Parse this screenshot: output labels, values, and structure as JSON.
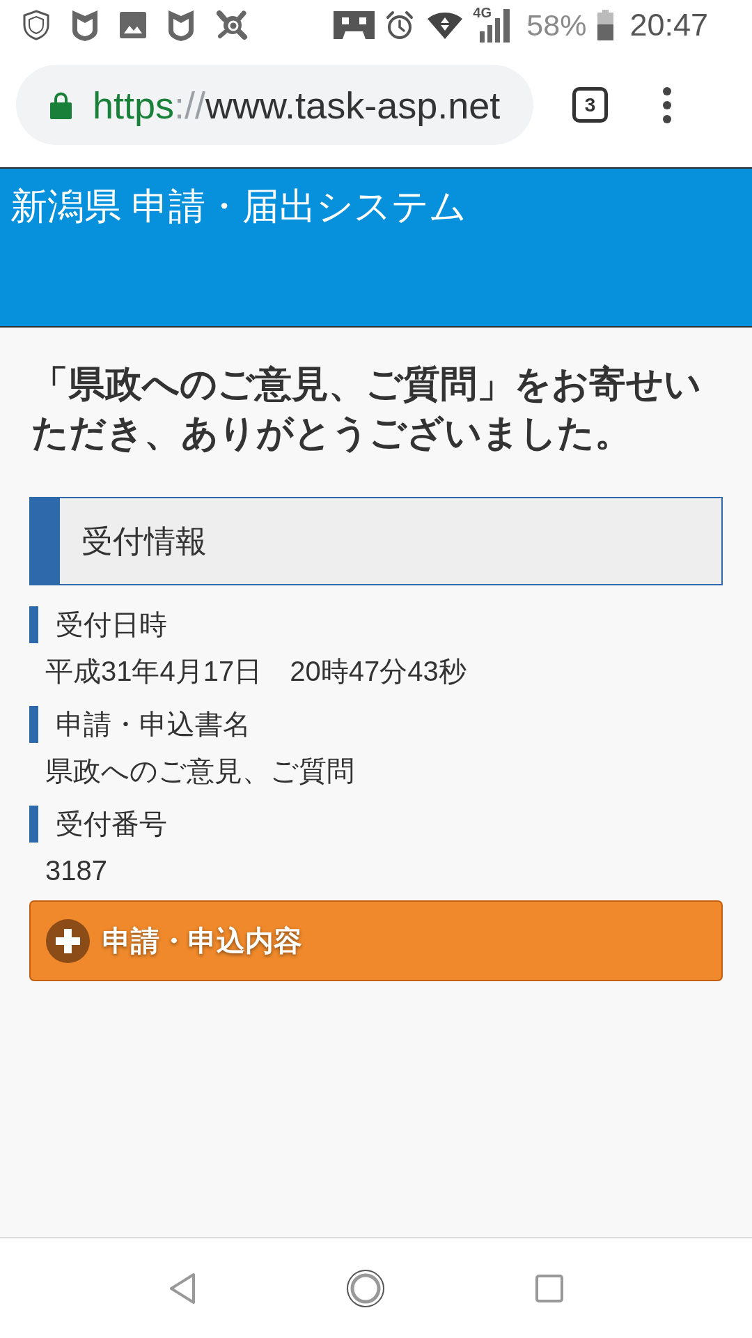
{
  "status_bar": {
    "network": "4G",
    "battery": "58%",
    "time": "20:47"
  },
  "browser": {
    "url": {
      "scheme": "https",
      "separator": "://",
      "host": "www.task-asp.net"
    },
    "tab_count": "3"
  },
  "header": {
    "title": "新潟県 申請・届出システム"
  },
  "message": "「県政へのご意見、ご質問」をお寄せいただき、ありがとうございました。",
  "section": {
    "title": "受付情報"
  },
  "fields": [
    {
      "label": "受付日時",
      "value": "平成31年4月17日　20時47分43秒"
    },
    {
      "label": "申請・申込書名",
      "value": "県政へのご意見、ご質問"
    },
    {
      "label": "受付番号",
      "value": "3187"
    }
  ],
  "expand_button": {
    "label": "申請・申込内容",
    "expanded": false
  }
}
